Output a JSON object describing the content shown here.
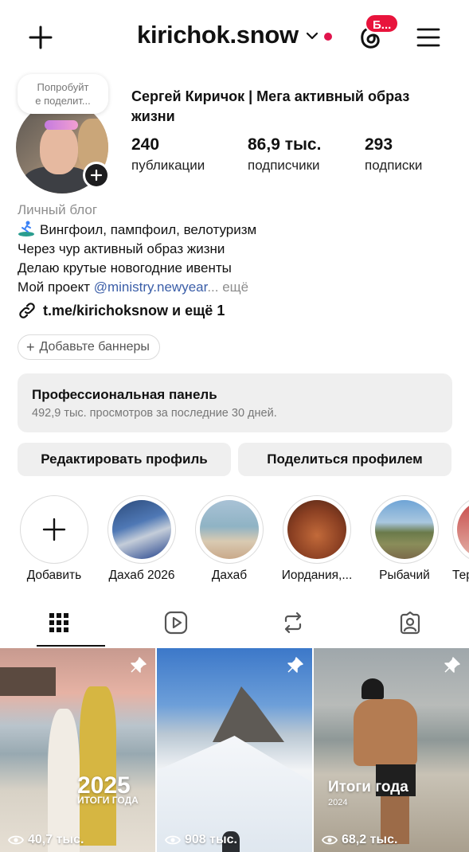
{
  "header": {
    "username": "kirichok.snow",
    "badge_text": "Б...",
    "colors": {
      "notification_dot": "#e0144c",
      "badge": "#e8143c"
    }
  },
  "profile": {
    "note_line1": "Попробуйт",
    "note_line2": "е поделит...",
    "full_name": "Сергей Киричок | Мега активный образ жизни",
    "stats": {
      "posts": {
        "value": "240",
        "label": "публикации"
      },
      "followers": {
        "value": "86,9 тыс.",
        "label": "подписчики"
      },
      "following": {
        "value": "293",
        "label": "подписки"
      }
    }
  },
  "bio": {
    "category": "Личный блог",
    "line1": "Вингфоил, пампфоил, велотуризм",
    "line2": "Через чур активный образ жизни",
    "line3": "Делаю крутые новогодние ивенты",
    "line4_prefix": "Мой проект ",
    "line4_mention": "@ministry.newyear",
    "line4_more": "... ещё",
    "link": "t.me/kirichoksnow и ещё 1",
    "add_banners": "Добавьте баннеры"
  },
  "professional_panel": {
    "title": "Профессиональная панель",
    "subtitle": "492,9 тыс. просмотров за последние 30 дней."
  },
  "actions": {
    "edit_profile": "Редактировать профиль",
    "share_profile": "Поделиться профилем"
  },
  "highlights": [
    {
      "label": "Добавить"
    },
    {
      "label": "Дахаб 2026"
    },
    {
      "label": "Дахаб"
    },
    {
      "label": "Иордания,..."
    },
    {
      "label": "Рыбачий"
    },
    {
      "label": "Тер"
    }
  ],
  "tabs": [
    {
      "icon": "grid-icon",
      "active": true
    },
    {
      "icon": "reels-icon",
      "active": false
    },
    {
      "icon": "reposts-icon",
      "active": false
    },
    {
      "icon": "tagged-icon",
      "active": false
    }
  ],
  "posts": [
    {
      "views": "40,7 тыс.",
      "overlay_year": "2025",
      "overlay_caption": "ИТОГИ ГОДА",
      "pinned": true
    },
    {
      "views": "908 тыс.",
      "pinned": true
    },
    {
      "views": "68,2 тыс.",
      "overlay_title": "Итоги года",
      "overlay_year": "2024",
      "pinned": true
    }
  ]
}
